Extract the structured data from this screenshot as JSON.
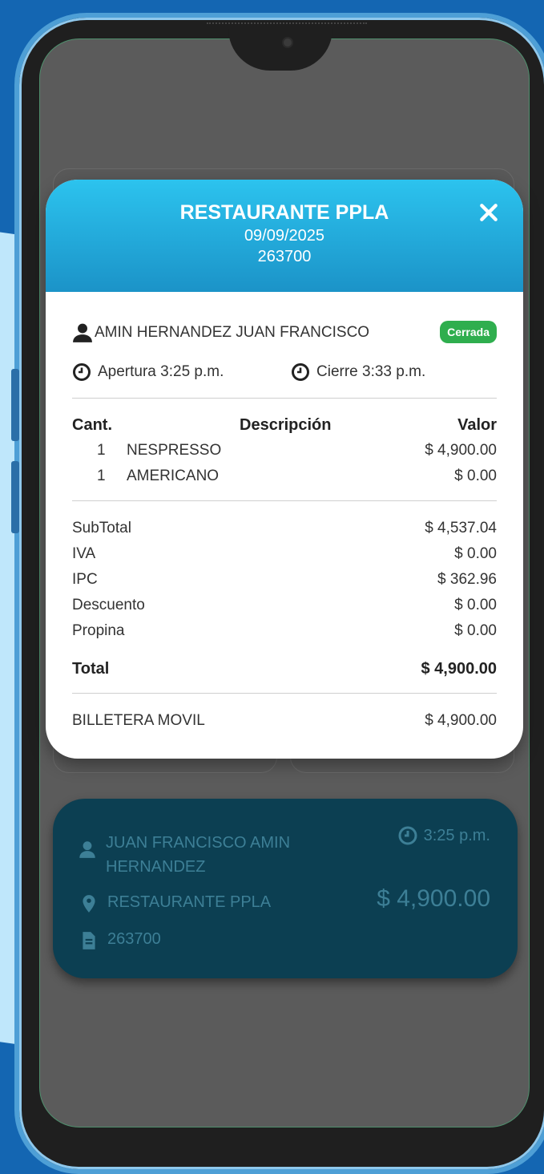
{
  "modal": {
    "title": "RESTAURANTE PPLA",
    "date": "09/09/2025",
    "id": "263700",
    "client": "AMIN HERNANDEZ JUAN FRANCISCO",
    "status": "Cerrada",
    "open_time": "Apertura 3:25 p.m.",
    "close_time": "Cierre 3:33 p.m.",
    "headers": {
      "qty": "Cant.",
      "desc": "Descripción",
      "value": "Valor"
    },
    "items": [
      {
        "qty": "1",
        "desc": "NESPRESSO",
        "value": "$ 4,900.00"
      },
      {
        "qty": "1",
        "desc": "AMERICANO",
        "value": "$ 0.00"
      }
    ],
    "summary": [
      {
        "label": "SubTotal",
        "value": "$ 4,537.04"
      },
      {
        "label": "IVA",
        "value": "$ 0.00"
      },
      {
        "label": "IPC",
        "value": "$ 362.96"
      },
      {
        "label": "Descuento",
        "value": "$ 0.00"
      },
      {
        "label": "Propina",
        "value": "$ 0.00"
      }
    ],
    "total_label": "Total",
    "total_value": "$ 4,900.00",
    "payment_method": "BILLETERA MOVIL",
    "payment_value": "$ 4,900.00"
  },
  "background_card": {
    "client": "JUAN FRANCISCO AMIN HERNANDEZ",
    "client_line1": "JUAN FRANCISCO AMIN",
    "client_line2": "HERNANDEZ",
    "time": "3:25 p.m.",
    "location": "RESTAURANTE PPLA",
    "amount": "$ 4,900.00",
    "doc_id": "263700"
  },
  "colors": {
    "header_top": "#2cc3ee",
    "header_bottom": "#1b93c8",
    "status_badge": "#2fae4e",
    "tx_card": "#0c3f52"
  }
}
